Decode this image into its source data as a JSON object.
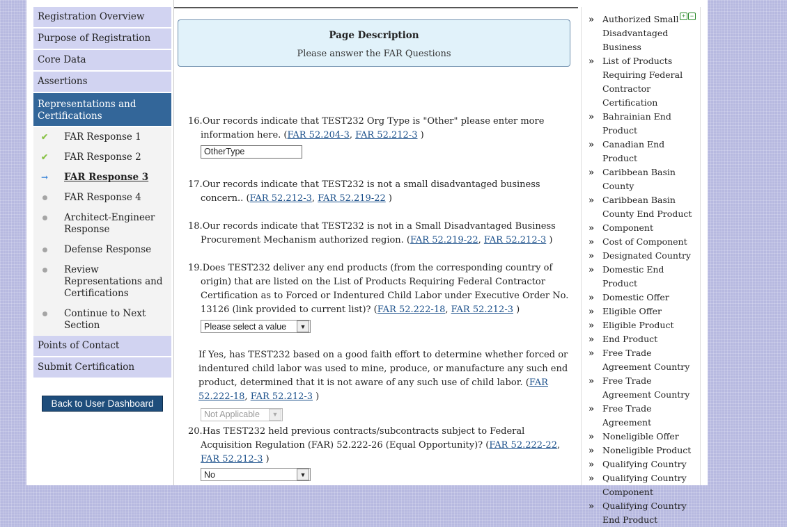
{
  "nav": {
    "main_top": [
      "Registration Overview",
      "Purpose of Registration",
      "Core Data",
      "Assertions"
    ],
    "active": "Representations and Certifications",
    "sub_items": [
      {
        "label": "FAR Response 1",
        "status": "check"
      },
      {
        "label": "FAR Response 2",
        "status": "check"
      },
      {
        "label": "FAR Response 3",
        "status": "current"
      },
      {
        "label": "FAR Response 4",
        "status": "dot"
      },
      {
        "label": "Architect-Engineer Response",
        "status": "dot"
      },
      {
        "label": "Defense Response",
        "status": "dot"
      },
      {
        "label": "Review Representations and Certifications",
        "status": "dot"
      },
      {
        "label": "Continue to Next Section",
        "status": "dot"
      }
    ],
    "main_bottom": [
      "Points of Contact",
      "Submit Certification"
    ],
    "back_button": "Back to User Dashboard"
  },
  "description": {
    "title": "Page Description",
    "text": "Please answer the FAR Questions"
  },
  "questions": {
    "q16": {
      "num": "16.",
      "text": "Our records indicate that TEST232 Org Type is \"Other\" please enter more information here. (",
      "link1": "FAR 52.204-3",
      "link2": "FAR 52.212-3",
      "input_value": "OtherType"
    },
    "q17": {
      "num": "17.",
      "text": "Our records indicate that TEST232 is not a small disadvantaged business concern.. (",
      "link1": "FAR 52.212-3",
      "link2": "FAR 52.219-22"
    },
    "q18": {
      "num": "18.",
      "text": "Our records indicate that TEST232 is not in a Small Disadvantaged Business Procurement Mechanism authorized region. (",
      "link1": "FAR 52.219-22",
      "link2": "FAR 52.212-3"
    },
    "q19": {
      "num": "19.",
      "text": "Does TEST232 deliver any end products (from the corresponding country of origin) that are listed on the List of Products Requiring Federal Contractor Certification as to Forced or Indentured Child Labor under Executive Order No. 13126 (link provided to current list)? (",
      "link1": "FAR 52.222-18",
      "link2": "FAR 52.212-3",
      "select_value": "Please select a value",
      "followup_text": "If Yes, has TEST232 based on a good faith effort to determine whether forced or indentured child labor was used to mine, produce, or manufacture any such end product, determined that it is not aware of any such use of child labor. (",
      "followup_link1": "FAR 52.222-18",
      "followup_link2": "FAR 52.212-3",
      "followup_select": "Not Applicable"
    },
    "q20": {
      "num": "20.",
      "text": "Has TEST232 held previous contracts/subcontracts subject to Federal Acquisition Regulation (FAR) 52.222-26 (Equal Opportunity)? (",
      "link1": "FAR 52.222-22",
      "link2": "FAR 52.212-3",
      "select_value": "No"
    },
    "sep": ", ",
    "close": " )"
  },
  "glossary": {
    "items": [
      "Authorized Small Disadvantaged Business",
      "List of Products Requiring Federal Contractor Certification",
      "Bahrainian End Product",
      "Canadian End Product",
      "Caribbean Basin County",
      "Caribbean Basin County End Product",
      "Component",
      "Cost of Component",
      "Designated Country",
      "Domestic End Product",
      "Domestic Offer",
      "Eligible Offer",
      "Eligible Product",
      "End Product",
      "Free Trade Agreement Country",
      "Free Trade Agreement Country",
      "Free Trade Agreement",
      "Noneligible Offer",
      "Noneligible Product",
      "Qualifying Country",
      "Qualifying Country Component",
      "Qualifying Country End Product"
    ]
  }
}
